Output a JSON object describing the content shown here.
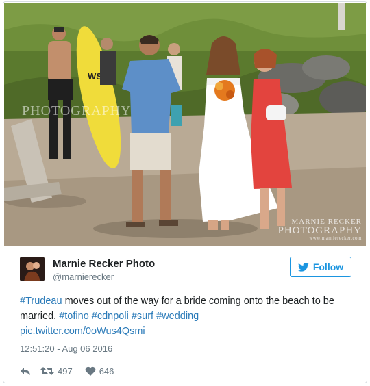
{
  "tweet": {
    "display_name": "Marnie Recker Photo",
    "handle": "@marnierecker",
    "follow_label": "Follow",
    "text_parts": {
      "t1": "#Trudeau",
      "t2": " moves out of the way for a bride coming onto the beach to be married. ",
      "t3": "#tofino",
      "t4": " ",
      "t5": "#cdnpoli",
      "t6": " ",
      "t7": "#surf",
      "t8": " ",
      "t9": "#wedding",
      "t10": "pic.twitter.com/0oWus4Qsmi"
    },
    "timestamp": "12:51:20 - Aug 06 2016",
    "retweet_count": "497",
    "like_count": "646"
  },
  "photo": {
    "watermark_left": "PHOTOGRAPHY",
    "watermark_right_top": "MARNIE RECKER",
    "watermark_right_main": "PHOTOGRAPHY",
    "watermark_right_url": "www.marnierecker.com",
    "surfboard_brand": "WS"
  },
  "icons": {
    "bird": "twitter-bird-icon",
    "reply": "reply-icon",
    "retweet": "retweet-icon",
    "like": "heart-icon"
  },
  "colors": {
    "link": "#2b7bb9",
    "follow": "#1b95e0",
    "muted": "#697882"
  }
}
